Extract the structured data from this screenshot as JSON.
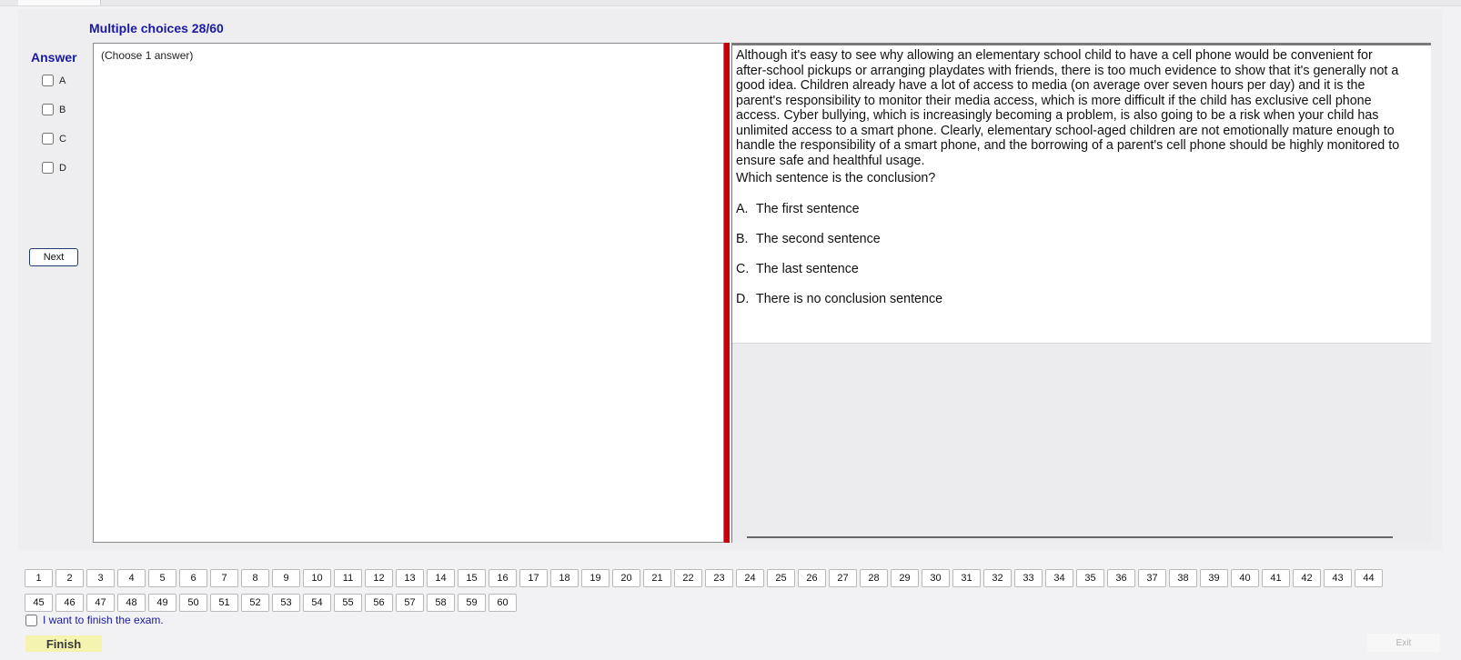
{
  "header": {
    "title": "Multiple choices 28/60"
  },
  "answer_panel": {
    "title": "Answer",
    "options": [
      "A",
      "B",
      "C",
      "D"
    ],
    "next_label": "Next"
  },
  "question_area": {
    "hint": "(Choose 1 answer)"
  },
  "passage": {
    "text": "Although it's easy to see why allowing an elementary school child to have a cell phone would be convenient for after-school pickups or arranging playdates with friends, there is too much evidence to show that it's generally not a good idea. Children already have a lot of access to media (on average over seven hours per day) and it is the parent's responsibility to monitor their media access, which is more difficult if the child has exclusive cell phone access. Cyber bullying, which is increasingly becoming a problem, is also going to be a risk when your child has unlimited access to a smart phone. Clearly, elementary school-aged children are not emotionally mature enough to handle the responsibility of a smart phone, and the borrowing of a parent's cell phone should be highly monitored to ensure safe and healthful usage.",
    "question": "Which sentence is the conclusion?",
    "choices": [
      {
        "letter": "A.",
        "text": "The first sentence"
      },
      {
        "letter": "B.",
        "text": "The second sentence"
      },
      {
        "letter": "C.",
        "text": "The last sentence"
      },
      {
        "letter": "D.",
        "text": "There is no conclusion sentence"
      }
    ]
  },
  "question_nav": {
    "row1": [
      "1",
      "2",
      "3",
      "4",
      "5",
      "6",
      "7",
      "8",
      "9",
      "10",
      "11",
      "12",
      "13",
      "14",
      "15",
      "16",
      "17",
      "18",
      "19",
      "20",
      "21",
      "22",
      "23",
      "24",
      "25",
      "26",
      "27",
      "28",
      "29",
      "30",
      "31",
      "32",
      "33",
      "34",
      "35",
      "36",
      "37",
      "38",
      "39",
      "40",
      "41",
      "42",
      "43",
      "44"
    ],
    "row2": [
      "45",
      "46",
      "47",
      "48",
      "49",
      "50",
      "51",
      "52",
      "53",
      "54",
      "55",
      "56",
      "57",
      "58",
      "59",
      "60"
    ]
  },
  "footer": {
    "finish_check_label": "I want to finish the exam.",
    "finish_label": "Finish",
    "exit_label": "Exit"
  }
}
